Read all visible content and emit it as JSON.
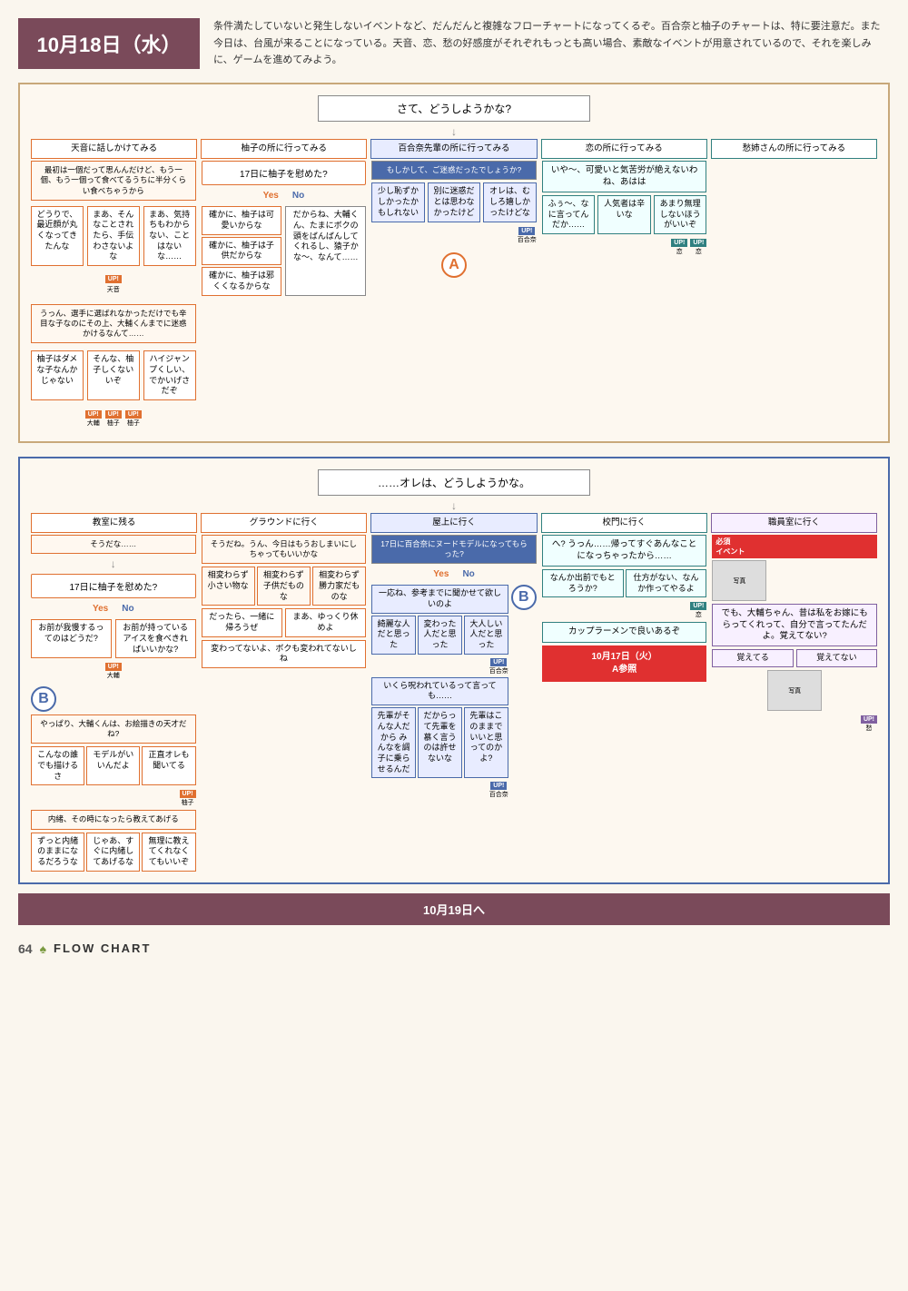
{
  "page": {
    "number": "64",
    "footer_title": "FLOW CHART",
    "background_color": "#faf6ee"
  },
  "header": {
    "date": "10月18日（水）",
    "description": "条件満たしていないと発生しないイベントなど、だんだんと複雑なフローチャートになってくるぞ。百合奈と柚子のチャートは、特に要注意だ。また今日は、台風が来ることになっている。天音、恋、愁の好感度がそれぞれもっとも高い場合、素敵なイベントが用意されているので、それを楽しみに、ゲームを進めてみよう。"
  },
  "top_flowchart": {
    "start_box": "さて、どうしようかな?",
    "branches": [
      "天音に話しかけてみる",
      "柚子の所に行ってみる",
      "百合奈先輩の所に行ってみる",
      "恋の所に行ってみる",
      "愁姉さんの所に行ってみる"
    ],
    "section_a_label": "A",
    "middle_box": "……オレは、どうしようかな。",
    "bottom_branches": [
      "教室に残る",
      "グラウンドに行く",
      "屋上に行く",
      "校門に行く",
      "職員室に行く"
    ]
  },
  "bottom_destination": "10月19日へ",
  "colors": {
    "orange": "#e07030",
    "blue": "#4a6aaa",
    "purple": "#8060a0",
    "teal": "#308080",
    "green": "#40a060",
    "dark_brown": "#7a4a5a",
    "red": "#e03030"
  }
}
